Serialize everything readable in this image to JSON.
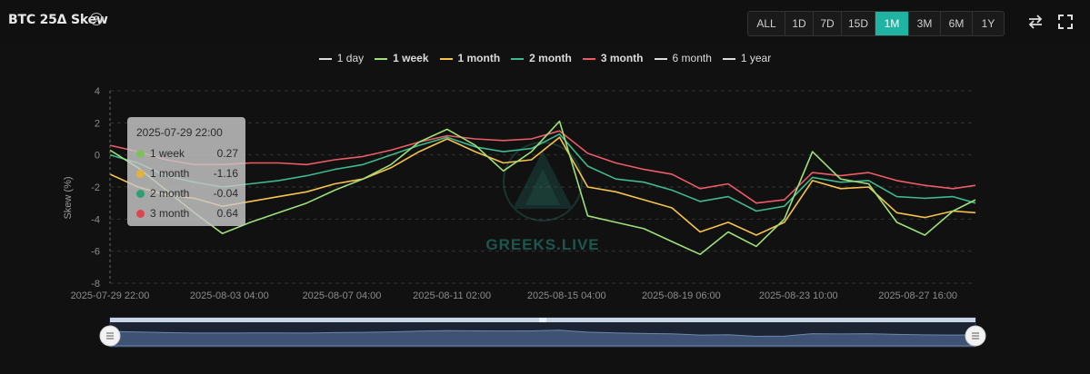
{
  "header": {
    "title": "BTC 25Δ Skew",
    "help_icon": "?",
    "ranges": [
      {
        "label": "ALL",
        "active": false
      },
      {
        "label": "1D",
        "active": false
      },
      {
        "label": "7D",
        "active": false
      },
      {
        "label": "15D",
        "active": false
      },
      {
        "label": "1M",
        "active": true
      },
      {
        "label": "3M",
        "active": false
      },
      {
        "label": "6M",
        "active": false
      },
      {
        "label": "1Y",
        "active": false
      }
    ],
    "tools": [
      "swap-icon",
      "fullscreen-icon"
    ]
  },
  "legend": [
    {
      "label": "1 day",
      "color": "#dddddd",
      "bold": false
    },
    {
      "label": "1 week",
      "color": "#9ee07a",
      "bold": true
    },
    {
      "label": "1 month",
      "color": "#f6c34d",
      "bold": true
    },
    {
      "label": "2 month",
      "color": "#3fb98d",
      "bold": true
    },
    {
      "label": "3 month",
      "color": "#ec5c66",
      "bold": true
    },
    {
      "label": "6 month",
      "color": "#dddddd",
      "bold": false
    },
    {
      "label": "1 year",
      "color": "#dddddd",
      "bold": false
    }
  ],
  "tooltip": {
    "date": "2025-07-29 22:00",
    "rows": [
      {
        "name": "1 week",
        "value": "0.27",
        "color": "#7fbf5f"
      },
      {
        "name": "1 month",
        "value": "-1.16",
        "color": "#e0b23e"
      },
      {
        "name": "2 month",
        "value": "-0.04",
        "color": "#2f9e74"
      },
      {
        "name": "3 month",
        "value": "0.64",
        "color": "#d9474f"
      }
    ]
  },
  "watermark": "GREEKS.LIVE",
  "chart_data": {
    "type": "line",
    "ylabel": "Skew (%)",
    "ylim": [
      -8,
      4
    ],
    "yticks": [
      4,
      2,
      0,
      -2,
      -4,
      -6,
      -8
    ],
    "x_tick_labels": [
      "2025-07-29 22:00",
      "2025-08-03 04:00",
      "2025-08-07 04:00",
      "2025-08-11 02:00",
      "2025-08-15 04:00",
      "2025-08-19 06:00",
      "2025-08-23 10:00",
      "2025-08-27 16:00"
    ],
    "x_range_days": [
      0,
      30.8
    ],
    "x_tick_days": [
      0,
      4.25,
      8.25,
      12.17,
      16.25,
      20.33,
      24.5,
      28.75
    ],
    "grid": true,
    "series": [
      {
        "name": "3 month",
        "color": "#ec5c66",
        "x": [
          0,
          1,
          2,
          3,
          4,
          5,
          6,
          7,
          8,
          9,
          10,
          11,
          12,
          13,
          14,
          15,
          16,
          17,
          18,
          19,
          20,
          21,
          22,
          23,
          24,
          25,
          26,
          27,
          28,
          29,
          30,
          30.8
        ],
        "y": [
          0.6,
          0.2,
          -0.3,
          -0.6,
          -0.6,
          -0.5,
          -0.5,
          -0.6,
          -0.3,
          -0.1,
          0.3,
          0.8,
          1.2,
          1.0,
          0.9,
          1.0,
          1.5,
          0.1,
          -0.5,
          -0.9,
          -1.2,
          -2.1,
          -1.8,
          -3.0,
          -2.8,
          -1.1,
          -1.3,
          -1.1,
          -1.6,
          -1.9,
          -2.1,
          -1.9
        ]
      },
      {
        "name": "2 month",
        "color": "#3fb98d",
        "x": [
          0,
          1,
          2,
          3,
          4,
          5,
          6,
          7,
          8,
          9,
          10,
          11,
          12,
          13,
          14,
          15,
          16,
          17,
          18,
          19,
          20,
          21,
          22,
          23,
          24,
          25,
          26,
          27,
          28,
          29,
          30,
          30.8
        ],
        "y": [
          0.0,
          -0.5,
          -1.3,
          -1.7,
          -2.0,
          -1.8,
          -1.6,
          -1.3,
          -0.9,
          -0.6,
          0.0,
          0.6,
          1.1,
          0.5,
          0.2,
          0.4,
          1.3,
          -0.7,
          -1.5,
          -1.7,
          -2.2,
          -2.9,
          -2.6,
          -3.5,
          -3.2,
          -1.4,
          -1.7,
          -1.6,
          -2.6,
          -2.7,
          -2.6,
          -3.0
        ]
      },
      {
        "name": "1 month",
        "color": "#f6c34d",
        "x": [
          0,
          1,
          2,
          3,
          4,
          5,
          6,
          7,
          8,
          9,
          10,
          11,
          12,
          13,
          14,
          15,
          16,
          17,
          18,
          19,
          20,
          21,
          22,
          23,
          24,
          25,
          26,
          27,
          28,
          29,
          30,
          30.8
        ],
        "y": [
          -1.2,
          -2.0,
          -2.5,
          -2.7,
          -3.2,
          -2.9,
          -2.6,
          -2.3,
          -1.8,
          -1.5,
          -0.8,
          0.2,
          1.0,
          0.2,
          -0.5,
          -0.3,
          1.1,
          -2.0,
          -2.3,
          -2.8,
          -3.3,
          -4.8,
          -4.2,
          -5.0,
          -4.2,
          -1.6,
          -2.1,
          -2.0,
          -3.6,
          -3.9,
          -3.5,
          -3.6
        ]
      },
      {
        "name": "1 week",
        "color": "#9ee07a",
        "x": [
          0,
          1,
          2,
          3,
          4,
          5,
          6,
          7,
          8,
          9,
          10,
          11,
          12,
          13,
          14,
          15,
          16,
          17,
          18,
          19,
          20,
          21,
          22,
          23,
          24,
          25,
          26,
          27,
          28,
          29,
          30,
          30.8
        ],
        "y": [
          0.3,
          -0.8,
          -2.2,
          -3.6,
          -4.9,
          -4.2,
          -3.6,
          -3.0,
          -2.2,
          -1.5,
          -0.6,
          0.8,
          1.6,
          0.6,
          -1.0,
          0.2,
          2.1,
          -3.8,
          -4.2,
          -4.6,
          -5.4,
          -6.2,
          -4.8,
          -5.7,
          -4.0,
          0.2,
          -1.5,
          -1.8,
          -4.2,
          -5.0,
          -3.5,
          -2.8
        ]
      }
    ]
  }
}
